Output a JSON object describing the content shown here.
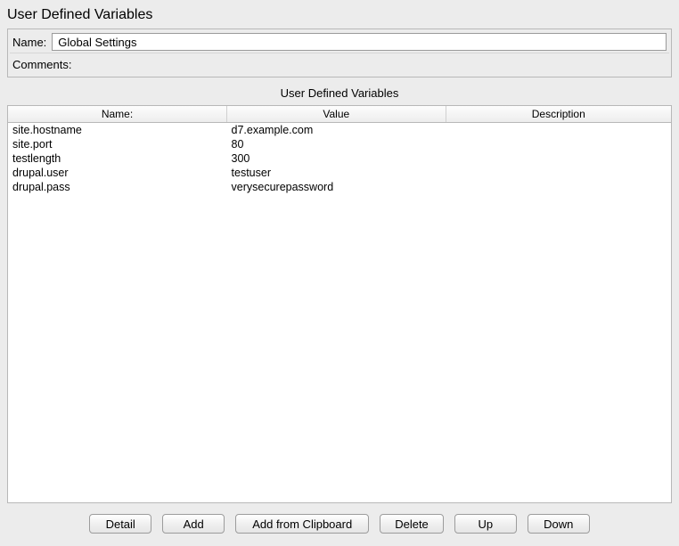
{
  "title": "User Defined Variables",
  "fields": {
    "name_label": "Name:",
    "name_value": "Global Settings",
    "comments_label": "Comments:",
    "comments_value": ""
  },
  "section_header": "User Defined Variables",
  "table": {
    "headers": {
      "name": "Name:",
      "value": "Value",
      "description": "Description"
    },
    "rows": [
      {
        "name": "site.hostname",
        "value": "d7.example.com",
        "description": ""
      },
      {
        "name": "site.port",
        "value": "80",
        "description": ""
      },
      {
        "name": "testlength",
        "value": "300",
        "description": ""
      },
      {
        "name": "drupal.user",
        "value": "testuser",
        "description": ""
      },
      {
        "name": "drupal.pass",
        "value": "verysecurepassword",
        "description": ""
      }
    ]
  },
  "buttons": {
    "detail": "Detail",
    "add": "Add",
    "add_clipboard": "Add from Clipboard",
    "delete": "Delete",
    "up": "Up",
    "down": "Down"
  }
}
